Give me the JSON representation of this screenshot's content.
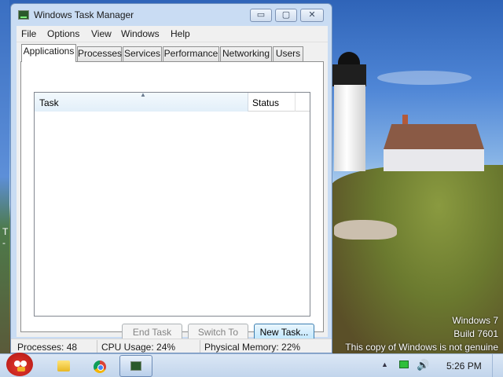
{
  "window": {
    "title": "Windows Task Manager",
    "min_symbol": "▭",
    "max_symbol": "▢",
    "close_symbol": "✕"
  },
  "menu": [
    "File",
    "Options",
    "View",
    "Windows",
    "Help"
  ],
  "tabs": [
    "Applications",
    "Processes",
    "Services",
    "Performance",
    "Networking",
    "Users"
  ],
  "active_tab": "Applications",
  "list": {
    "columns": [
      "Task",
      "Status"
    ],
    "sort_indicator": "▲",
    "rows": []
  },
  "buttons": {
    "end_task": "End Task",
    "switch_to": "Switch To",
    "new_task": "New Task..."
  },
  "status": {
    "processes": "Processes: 48",
    "cpu": "CPU Usage: 24%",
    "memory": "Physical Memory: 22%"
  },
  "desktop": {
    "edge_text": "T\n-",
    "watermark": [
      "Windows 7",
      "Build 7601",
      "This copy of Windows is not genuine"
    ]
  },
  "taskbar": {
    "clock": "5:26 PM",
    "tray_arrow": "▲",
    "volume_symbol": "🔊",
    "icons": [
      "angry-birds-icon",
      "windows-explorer-icon",
      "chrome-icon",
      "task-manager-icon"
    ]
  }
}
